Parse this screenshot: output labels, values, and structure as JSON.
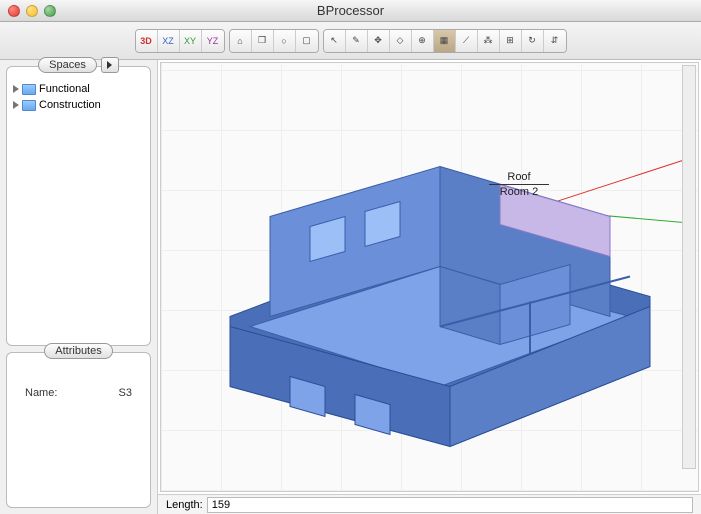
{
  "window": {
    "title": "BProcessor"
  },
  "toolbar": {
    "view_group": [
      "3D",
      "XZ",
      "XY",
      "YZ"
    ],
    "nav_group": [
      "home",
      "cube",
      "sphere",
      "box"
    ],
    "tool_group": [
      "arrow",
      "pencil",
      "compass",
      "diamond",
      "target",
      "fill",
      "measure",
      "wand",
      "split",
      "rotate",
      "align"
    ]
  },
  "sidebar": {
    "spaces": {
      "tab_label": "Spaces",
      "items": [
        {
          "label": "Functional"
        },
        {
          "label": "Construction"
        }
      ]
    },
    "attributes": {
      "tab_label": "Attributes",
      "rows": [
        {
          "label": "Name:",
          "value": "S3"
        }
      ]
    }
  },
  "viewport": {
    "labels": {
      "roof": "Roof",
      "room": "Room 2"
    }
  },
  "status": {
    "label": "Length:",
    "value": "159"
  },
  "colors": {
    "wall": "#5b7fc7",
    "wall_dark": "#3a5fa8",
    "floor": "#7fa3e8",
    "highlight": "#c8b8e8"
  }
}
